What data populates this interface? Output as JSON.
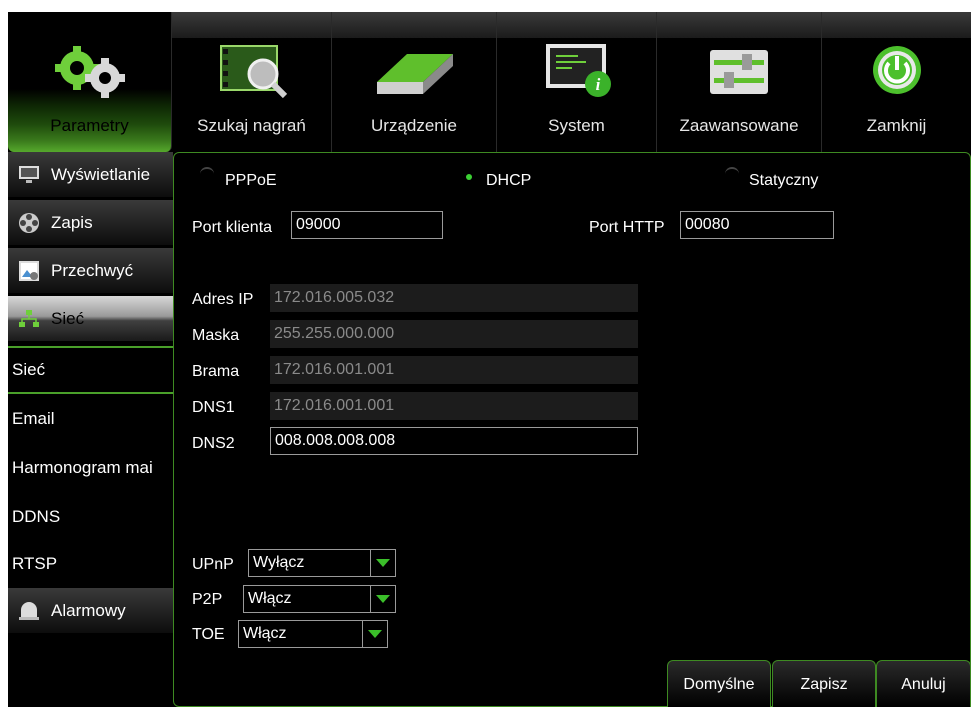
{
  "menu": [
    {
      "label": "Parametry",
      "icon": "gears-icon"
    },
    {
      "label": "Szukaj nagrań",
      "icon": "film-search-icon"
    },
    {
      "label": "Urządzenie",
      "icon": "hard-drive-icon"
    },
    {
      "label": "System",
      "icon": "system-info-icon"
    },
    {
      "label": "Zaawansowane",
      "icon": "sliders-icon"
    },
    {
      "label": "Zamknij",
      "icon": "power-icon"
    }
  ],
  "sidebar": {
    "main": [
      {
        "label": "Wyświetlanie",
        "icon": "monitor-icon"
      },
      {
        "label": "Zapis",
        "icon": "film-reel-icon"
      },
      {
        "label": "Przechwyć",
        "icon": "image-capture-icon"
      },
      {
        "label": "Sieć",
        "icon": "network-icon"
      },
      {
        "label": "Alarmowy",
        "icon": "alarm-icon"
      }
    ],
    "sub": [
      "Sieć",
      "Email",
      "Harmonogram mai",
      "DDNS",
      "RTSP"
    ]
  },
  "network": {
    "mode_pppoe": "PPPoE",
    "mode_dhcp": "DHCP",
    "mode_static": "Statyczny",
    "port_client_label": "Port klienta",
    "port_client_value": "09000",
    "port_http_label": "Port HTTP",
    "port_http_value": "00080",
    "ip_label": "Adres IP",
    "ip_value": "172.016.005.032",
    "mask_label": "Maska",
    "mask_value": "255.255.000.000",
    "gateway_label": "Brama",
    "gateway_value": "172.016.001.001",
    "dns1_label": "DNS1",
    "dns1_value": "172.016.001.001",
    "dns2_label": "DNS2",
    "dns2_value": "008.008.008.008",
    "upnp_label": "UPnP",
    "upnp_value": "Wyłącz",
    "p2p_label": "P2P",
    "p2p_value": "Włącz",
    "toe_label": "TOE",
    "toe_value": "Włącz"
  },
  "buttons": {
    "default": "Domyślne",
    "save": "Zapisz",
    "cancel": "Anuluj"
  },
  "colors": {
    "accent": "#3bd033",
    "border_green": "#3e8a22"
  }
}
